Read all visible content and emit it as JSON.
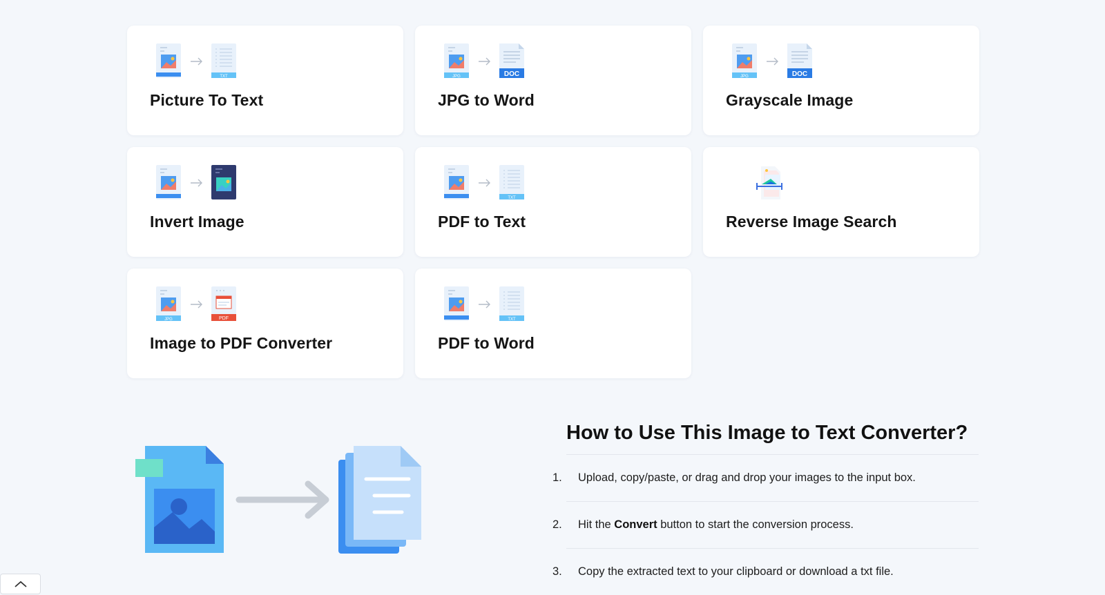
{
  "tools": [
    {
      "name": "picture-to-text",
      "title": "Picture To Text",
      "from": "image",
      "from_badge": "",
      "to": "txt",
      "to_badge": "TXT"
    },
    {
      "name": "jpg-to-word",
      "title": "JPG to Word",
      "from": "image",
      "from_badge": "JPG",
      "to": "doc",
      "to_badge": "DOC"
    },
    {
      "name": "grayscale-image",
      "title": "Grayscale Image",
      "from": "image",
      "from_badge": "JPG",
      "to": "doc",
      "to_badge": "DOC"
    },
    {
      "name": "invert-image",
      "title": "Invert Image",
      "from": "image",
      "from_badge": "",
      "to": "dark-image",
      "to_badge": ""
    },
    {
      "name": "pdf-to-text",
      "title": "PDF to Text",
      "from": "image",
      "from_badge": "",
      "to": "txt",
      "to_badge": "TXT"
    },
    {
      "name": "reverse-image-search",
      "title": "Reverse Image Search",
      "from": "search",
      "from_badge": "",
      "to": "",
      "to_badge": ""
    },
    {
      "name": "image-to-pdf-converter",
      "title": "Image to PDF Converter",
      "from": "image",
      "from_badge": "JPG",
      "to": "pdf",
      "to_badge": "PDF"
    },
    {
      "name": "pdf-to-word",
      "title": "PDF to Word",
      "from": "image",
      "from_badge": "",
      "to": "txt",
      "to_badge": "TXT"
    }
  ],
  "howto": {
    "title": "How to Use This Image to Text Converter?",
    "steps": [
      {
        "num": "1.",
        "pre": "Upload, copy/paste, or drag and drop your images to the input box.",
        "bold": "",
        "post": ""
      },
      {
        "num": "2.",
        "pre": "Hit the ",
        "bold": "Convert",
        "post": " button to start the conversion process."
      },
      {
        "num": "3.",
        "pre": "Copy the extracted text to your clipboard or download a txt file.",
        "bold": "",
        "post": ""
      }
    ]
  },
  "colors": {
    "accent": "#3b8ef0",
    "light_blue": "#64c2f7",
    "page_bg": "#f4f7fb",
    "pdf_red": "#e8503a",
    "dark_navy": "#2e3a6e"
  }
}
